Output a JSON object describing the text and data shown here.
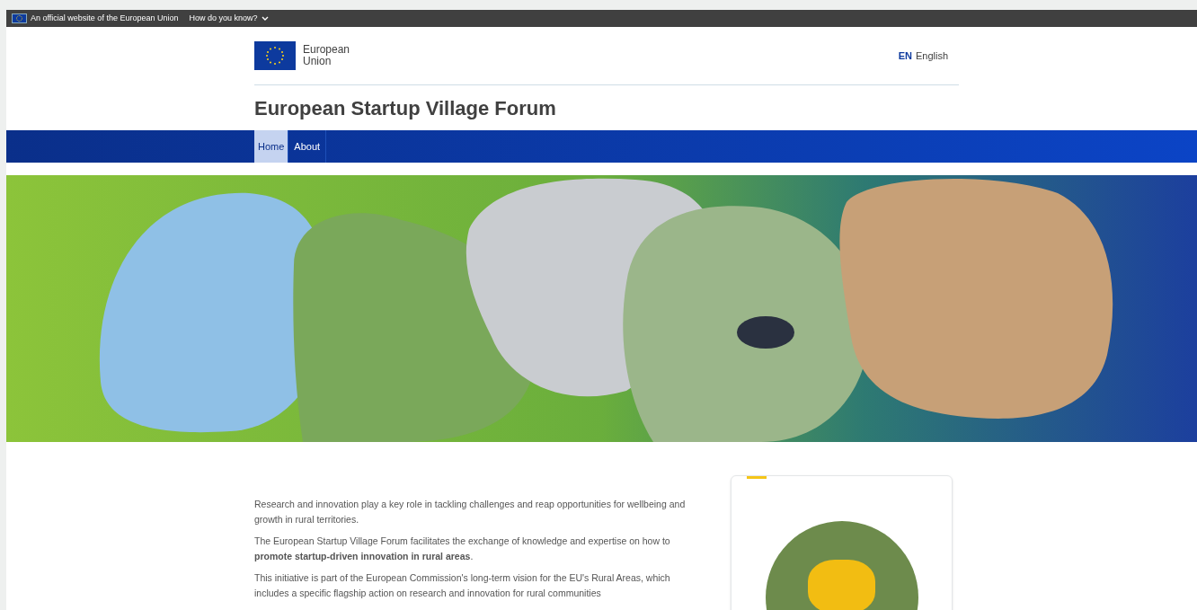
{
  "eu_banner": {
    "text": "An official website of the European Union",
    "link": "How do you know?"
  },
  "header": {
    "logo_text": [
      "European",
      "Union"
    ],
    "language": {
      "code": "EN",
      "name": "English"
    }
  },
  "site_title": "European Startup Village Forum",
  "nav": [
    {
      "label": "Home",
      "selected": true
    },
    {
      "label": "About",
      "selected": false
    }
  ],
  "intro": [
    "Research and innovation play a key role in tackling challenges and reap opportunities for wellbeing and growth in rural territories.",
    "The European Startup Village Forum facilitates the exchange of knowledge and expertise on how to **promote startup-driven innovation in rural areas**.",
    "This initiative is part of the European Commission's long-term vision for the EU's Rural Areas, which includes a specific flagship action on research and innovation for rural communities"
  ]
}
